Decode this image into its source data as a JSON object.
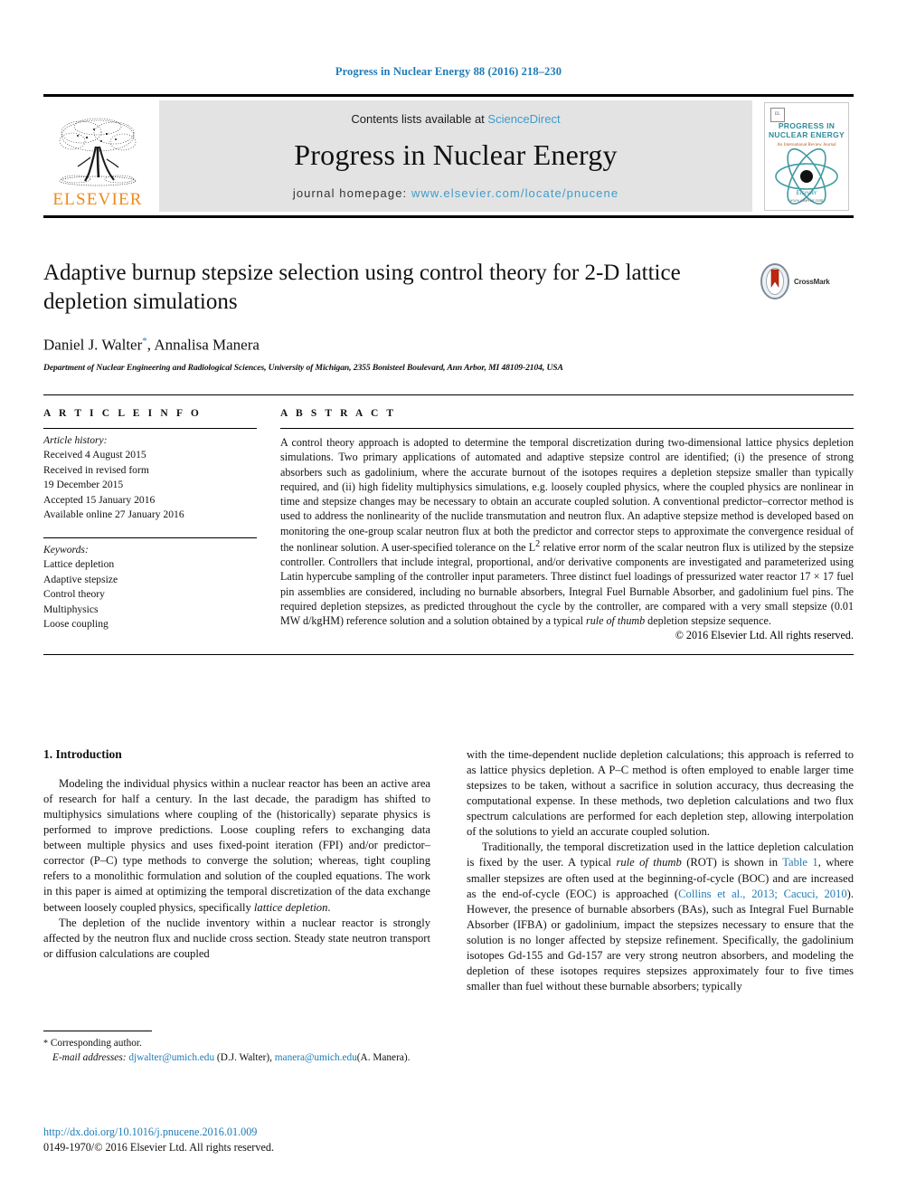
{
  "running_head": "Progress in Nuclear Energy 88 (2016) 218–230",
  "masthead": {
    "publisher_logo_text": "ELSEVIER",
    "contents_prefix": "Contents lists available at ",
    "contents_link": "ScienceDirect",
    "journal_title": "Progress in Nuclear Energy",
    "homepage_prefix": "journal homepage: ",
    "homepage_url": "www.elsevier.com/locate/pnucene",
    "cover": {
      "title_line1": "PROGRESS IN",
      "title_line2": "NUCLEAR ENERGY",
      "subtitle": "An International Review Journal",
      "footer_brand": "Elsevier",
      "footer_url": "www.elsevier.com"
    },
    "link_color": "#3d9ccc"
  },
  "article": {
    "title": "Adaptive burnup stepsize selection using control theory for 2-D lattice depletion simulations",
    "authors": "Daniel J. Walter",
    "authors_rest": ", Annalisa Manera",
    "corresponding_marker": "*",
    "affiliation": "Department of Nuclear Engineering and Radiological Sciences, University of Michigan, 2355 Bonisteel Boulevard, Ann Arbor, MI 48109-2104, USA",
    "crossmark_label": "CrossMark"
  },
  "article_info": {
    "heading": "A R T I C L E  I N F O",
    "history_label": "Article history:",
    "history": [
      "Received 4 August 2015",
      "Received in revised form",
      "19 December 2015",
      "Accepted 15 January 2016",
      "Available online 27 January 2016"
    ],
    "keywords_label": "Keywords:",
    "keywords": [
      "Lattice depletion",
      "Adaptive stepsize",
      "Control theory",
      "Multiphysics",
      "Loose coupling"
    ]
  },
  "abstract": {
    "heading": "A B S T R A C T",
    "part1": "A control theory approach is adopted to determine the temporal discretization during two-dimensional lattice physics depletion simulations. Two primary applications of automated and adaptive stepsize control are identified; (i) the presence of strong absorbers such as gadolinium, where the accurate burnout of the isotopes requires a depletion stepsize smaller than typically required, and (ii) high fidelity multiphysics simulations, e.g. loosely coupled physics, where the coupled physics are nonlinear in time and stepsize changes may be necessary to obtain an accurate coupled solution. A conventional predictor–corrector method is used to address the nonlinearity of the nuclide transmutation and neutron flux. An adaptive stepsize method is developed based on monitoring the one-group scalar neutron flux at both the predictor and corrector steps to approximate the convergence residual of the nonlinear solution. A user-specified tolerance on the L",
    "sup1": "2",
    "part2": " relative error norm of the scalar neutron flux is utilized by the stepsize controller. Controllers that include integral, proportional, and/or derivative components are investigated and parameterized using Latin hypercube sampling of the controller input parameters. Three distinct fuel loadings of pressurized water reactor 17 × 17 fuel pin assemblies are considered, including no burnable absorbers, Integral Fuel Burnable Absorber, and gadolinium fuel pins. The required depletion stepsizes, as predicted throughout the cycle by the controller, are compared with a very small stepsize (0.01 MW d/kgHM) reference solution and a solution obtained by a typical ",
    "italic_phrase": "rule of thumb",
    "part3": " depletion stepsize sequence.",
    "copyright": "© 2016 Elsevier Ltd. All rights reserved."
  },
  "body": {
    "section1_heading": "1. Introduction",
    "left_para1_a": "Modeling the individual physics within a nuclear reactor has been an active area of research for half a century. In the last decade, the paradigm has shifted to multiphysics simulations where coupling of the (historically) separate physics is performed to improve predictions. Loose coupling refers to exchanging data between multiple physics and uses fixed-point iteration (FPI) and/or predictor–corrector (P–C) type methods to converge the solution; whereas, tight coupling refers to a monolithic formulation and solution of the coupled equations. The work in this paper is aimed at optimizing the temporal discretization of the data exchange between loosely coupled physics, specifically ",
    "left_para1_italic": "lattice depletion",
    "left_para1_b": ".",
    "left_para2": "The depletion of the nuclide inventory within a nuclear reactor is strongly affected by the neutron flux and nuclide cross section. Steady state neutron transport or diffusion calculations are coupled",
    "right_para1": "with the time-dependent nuclide depletion calculations; this approach is referred to as lattice physics depletion. A P–C method is often employed to enable larger time stepsizes to be taken, without a sacrifice in solution accuracy, thus decreasing the computational expense. In these methods, two depletion calculations and two flux spectrum calculations are performed for each depletion step, allowing interpolation of the solutions to yield an accurate coupled solution.",
    "right_para2_a": "Traditionally, the temporal discretization used in the lattice depletion calculation is fixed by the user. A typical ",
    "right_para2_italic1": "rule of thumb",
    "right_para2_b": " (ROT) is shown in ",
    "right_para2_link1": "Table 1",
    "right_para2_c": ", where smaller stepsizes are often used at the beginning-of-cycle (BOC) and are increased as the end-of-cycle (EOC) is approached (",
    "right_para2_link2": "Collins et al., 2013; Cacuci, 2010",
    "right_para2_d": "). However, the presence of burnable absorbers (BAs), such as Integral Fuel Burnable Absorber (IFBA) or gadolinium, impact the stepsizes necessary to ensure that the solution is no longer affected by stepsize refinement. Specifically, the gadolinium isotopes Gd-155 and Gd-157 are very strong neutron absorbers, and modeling the depletion of these isotopes requires stepsizes approximately four to five times smaller than fuel without these burnable absorbers; typically"
  },
  "footnote": {
    "corresponding_marker": "*",
    "corresponding_text": " Corresponding author.",
    "email_label": "E-mail addresses:",
    "email1": "djwalter@umich.edu",
    "email1_name": " (D.J. Walter), ",
    "email2": "manera@umich.edu",
    "email2_name": "(A. Manera)."
  },
  "footer": {
    "doi": "http://dx.doi.org/10.1016/j.pnucene.2016.01.009",
    "issn": "0149-1970/© 2016 Elsevier Ltd. All rights reserved."
  },
  "colors": {
    "link": "#1f7bb6",
    "elsevier_orange": "#ec8a1e",
    "band_gray": "#e3e3e3"
  }
}
